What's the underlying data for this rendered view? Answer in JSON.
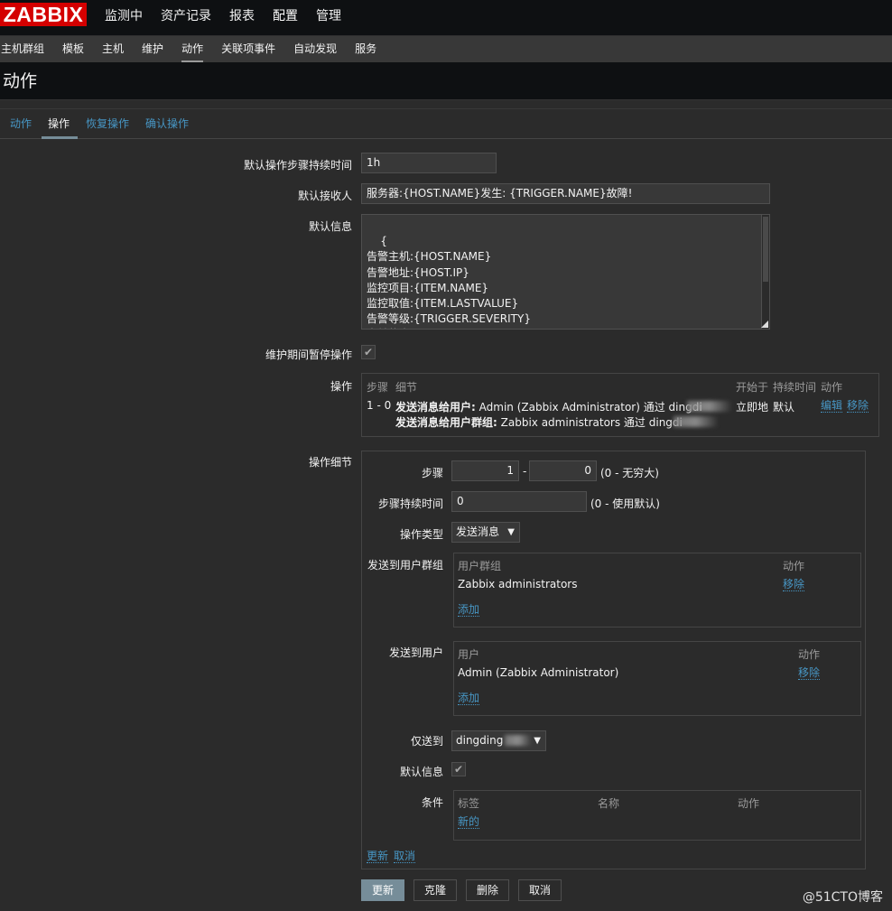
{
  "header": {
    "logo": "ZABBIX",
    "menu": [
      "监测中",
      "资产记录",
      "报表",
      "配置",
      "管理"
    ],
    "active_menu": "配置"
  },
  "submenu": {
    "items": [
      "主机群组",
      "模板",
      "主机",
      "维护",
      "动作",
      "关联项事件",
      "自动发现",
      "服务"
    ],
    "active": "动作"
  },
  "page_title": "动作",
  "tabs": {
    "items": [
      "动作",
      "操作",
      "恢复操作",
      "确认操作"
    ],
    "active": "操作"
  },
  "form": {
    "default_step_duration_label": "默认操作步骤持续时间",
    "default_step_duration_value": "1h",
    "default_subject_label": "默认接收人",
    "default_subject_value": "服务器:{HOST.NAME}发生: {TRIGGER.NAME}故障!",
    "default_message_label": "默认信息",
    "default_message_value": "{\n告警主机:{HOST.NAME}\n告警地址:{HOST.IP}\n监控项目:{ITEM.NAME}\n监控取值:{ITEM.LASTVALUE}\n告警等级:{TRIGGER.SEVERITY}\n当前状态:{TRIGGER.STATUS}\n告警信息",
    "pause_label": "维护期间暂停操作",
    "pause_checked": true,
    "operations_label": "操作"
  },
  "operations_table": {
    "col_steps": "步骤",
    "col_details": "细节",
    "col_start": "开始于",
    "col_duration": "持续时间",
    "col_action": "动作",
    "row": {
      "steps": "1 - 0",
      "line1_bold": "发送消息给用户:",
      "line1_rest": "Admin (Zabbix Administrator) 通过 dingdi",
      "line2_bold": "发送消息给用户群组:",
      "line2_rest": "Zabbix administrators 通过 dingdi",
      "start": "立即地",
      "duration": "默认",
      "edit": "编辑",
      "remove": "移除"
    }
  },
  "op_details": {
    "label": "操作细节",
    "steps_label": "步骤",
    "step_from": "1",
    "step_sep": "-",
    "step_to": "0",
    "step_hint": "(0 - 无穷大)",
    "step_duration_label": "步骤持续时间",
    "step_duration_value": "0",
    "step_duration_hint": "(0 - 使用默认)",
    "op_type_label": "操作类型",
    "op_type_value": "发送消息",
    "send_groups_label": "发送到用户群组",
    "groups_col_name": "用户群组",
    "groups_col_action": "动作",
    "group_name": "Zabbix administrators",
    "group_remove": "移除",
    "group_add": "添加",
    "send_users_label": "发送到用户",
    "users_col_name": "用户",
    "users_col_action": "动作",
    "user_name": "Admin (Zabbix Administrator)",
    "user_remove": "移除",
    "user_add": "添加",
    "only_send_label": "仅送到",
    "only_send_value": "dingding",
    "default_msg_label": "默认信息",
    "default_msg_checked": true,
    "conditions_label": "条件",
    "cond_col_label": "标签",
    "cond_col_name": "名称",
    "cond_col_action": "动作",
    "cond_new": "新的",
    "update_link": "更新",
    "cancel_link": "取消"
  },
  "buttons": {
    "update": "更新",
    "clone": "克隆",
    "delete": "删除",
    "cancel": "取消"
  },
  "watermark": "@51CTO博客"
}
